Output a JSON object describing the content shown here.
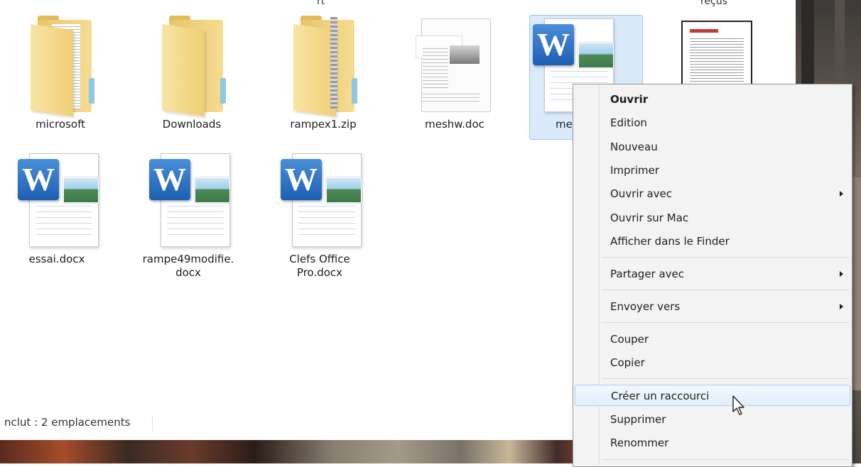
{
  "window": {
    "top_clipped_labels": [
      "rt",
      "reçus"
    ]
  },
  "files_row1": [
    {
      "name": "microsoft",
      "type": "folder"
    },
    {
      "name": "Downloads",
      "type": "folder"
    },
    {
      "name": "rampex1.zip",
      "type": "zip"
    },
    {
      "name": "meshw.doc",
      "type": "doc"
    },
    {
      "name": "me",
      "type": "docx",
      "selected": true
    }
  ],
  "files_row2": [
    {
      "name": "essai.docx",
      "type": "docx"
    },
    {
      "name": "rampe49modifie.docx",
      "line1": "rampe49modifie.",
      "line2": "docx",
      "type": "docx"
    },
    {
      "name": "Clefs Office Pro.docx",
      "line1": "Clefs Office",
      "line2": "Pro.docx",
      "type": "docx"
    }
  ],
  "status_bar": {
    "text": "nclut : 2 emplacements"
  },
  "context_menu": {
    "items": [
      {
        "label": "Ouvrir",
        "bold": true
      },
      {
        "label": "Edition"
      },
      {
        "label": "Nouveau"
      },
      {
        "label": "Imprimer"
      },
      {
        "label": "Ouvrir avec",
        "submenu": true
      },
      {
        "label": "Ouvrir sur Mac"
      },
      {
        "label": "Afficher dans le Finder"
      },
      {
        "label": "Partager avec",
        "submenu": true
      },
      {
        "label": "Envoyer vers",
        "submenu": true
      },
      {
        "label": "Couper"
      },
      {
        "label": "Copier"
      },
      {
        "label": "Créer un raccourci",
        "hovered": true
      },
      {
        "label": "Supprimer"
      },
      {
        "label": "Renommer"
      }
    ]
  },
  "icons": {
    "word_letter": "W"
  },
  "colors": {
    "selection": "#dbeafb",
    "menu_bg": "#f3f3f3",
    "word_blue": "#1d5fb3"
  }
}
